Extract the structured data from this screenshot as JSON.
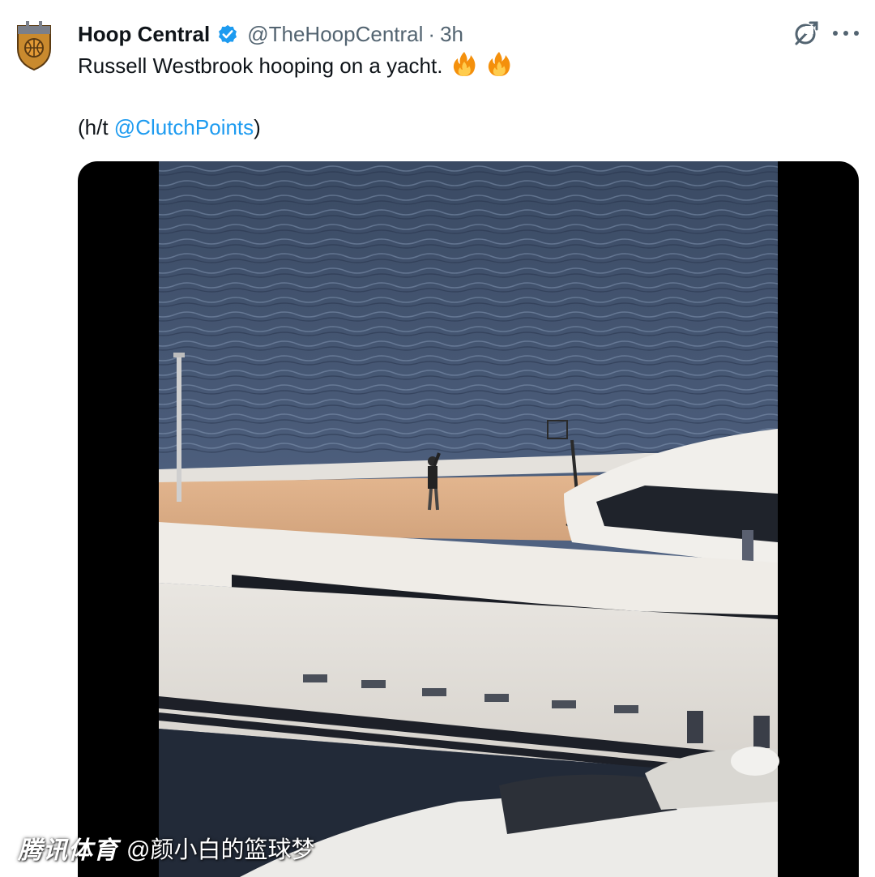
{
  "tweet": {
    "display_name": "Hoop Central",
    "verified_icon": "verified-badge-icon",
    "handle": "@TheHoopCentral",
    "separator": "·",
    "time": "3h",
    "text": "Russell Westbrook hooping on a yacht.",
    "emojis": [
      "fire-emoji",
      "fire-emoji"
    ],
    "ht_prefix": "(h/t ",
    "ht_mention": "@ClutchPoints",
    "ht_suffix": ")",
    "icons": {
      "grok": "grok-icon",
      "more": "more-icon"
    },
    "colors": {
      "text": "#0f1419",
      "secondary": "#536471",
      "link": "#1d9bf0",
      "verified": "#1d9bf0"
    }
  },
  "media": {
    "type": "video",
    "description_icon": "video-player"
  },
  "watermark": {
    "brand": "腾讯体育",
    "user": "@颜小白的篮球梦"
  }
}
